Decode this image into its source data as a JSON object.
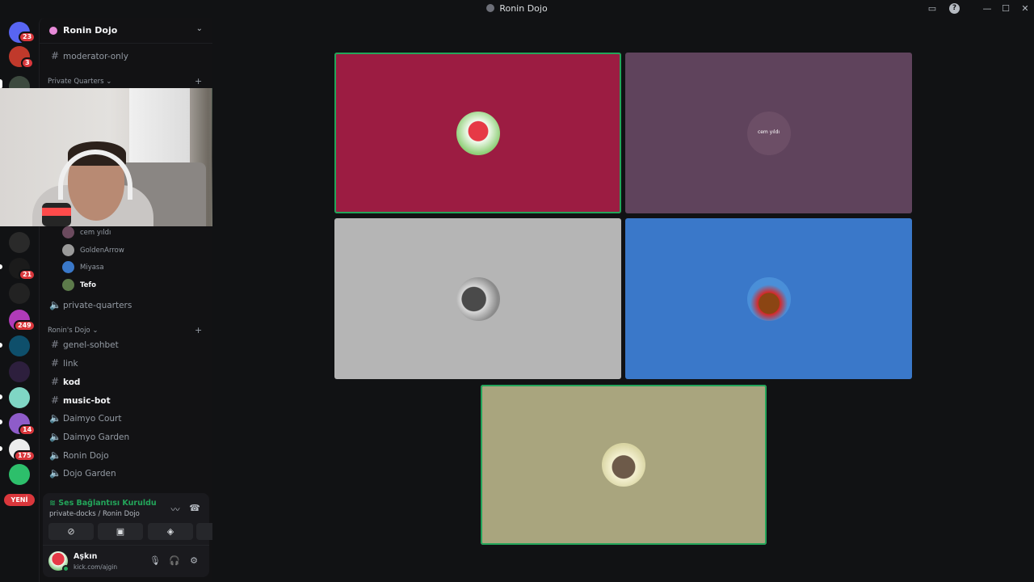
{
  "window": {
    "title": "Ronin Dojo"
  },
  "rail": {
    "badges": [
      "23",
      "3",
      "21",
      "249",
      "14",
      "175"
    ],
    "yeni_label": "YENİ"
  },
  "sidebar": {
    "guild_name": "Ronin Dojo",
    "top_channels": [
      {
        "name": "moderator-only",
        "type": "text"
      }
    ],
    "categories": [
      {
        "name": "Private Quarters"
      },
      {
        "name": "Ronin's Dojo"
      }
    ],
    "voice_users": [
      {
        "name": "cem yıldı"
      },
      {
        "name": "GoldenArrow"
      },
      {
        "name": "Miyasa"
      },
      {
        "name": "Tefo"
      }
    ],
    "private_voice": "private-quarters",
    "dojo_channels": [
      {
        "name": "genel-sohbet",
        "type": "text"
      },
      {
        "name": "link",
        "type": "text"
      },
      {
        "name": "kod",
        "type": "text"
      },
      {
        "name": "music-bot",
        "type": "text"
      },
      {
        "name": "Daimyo Court",
        "type": "voice"
      },
      {
        "name": "Daimyo Garden",
        "type": "voice"
      },
      {
        "name": "Ronin Dojo",
        "type": "voice"
      },
      {
        "name": "Dojo Garden",
        "type": "voice"
      }
    ]
  },
  "voice_panel": {
    "status": "Ses Bağlantısı Kuruldu",
    "location": "private-docks / Ronin Dojo"
  },
  "user": {
    "name": "Aşkın",
    "status": "kick.com/ajgin"
  },
  "stage": {
    "tiles": [
      {
        "color": "#9c1c42",
        "speaking": true,
        "avatar_text": ""
      },
      {
        "color": "#5f435c",
        "speaking": false,
        "avatar_text": "cem yıldı"
      },
      {
        "color": "#b5b5b5",
        "speaking": false,
        "avatar_text": ""
      },
      {
        "color": "#3a78c9",
        "speaking": false,
        "avatar_text": ""
      },
      {
        "color": "#a9a57e",
        "speaking": true,
        "avatar_text": ""
      }
    ]
  },
  "colors": {
    "accent_green": "#23a55a",
    "badge_red": "#da373c",
    "background": "#111214"
  },
  "icons": {
    "titlebar": [
      "inbox-icon",
      "help-icon",
      "minimize-icon",
      "maximize-icon",
      "close-icon"
    ],
    "voice_panel": [
      "noise-suppression-icon",
      "disconnect-icon",
      "camera-off-icon",
      "screen-share-icon",
      "activity-icon",
      "soundboard-icon"
    ],
    "user_area": [
      "microphone-icon",
      "headphones-icon",
      "settings-gear-icon"
    ]
  }
}
